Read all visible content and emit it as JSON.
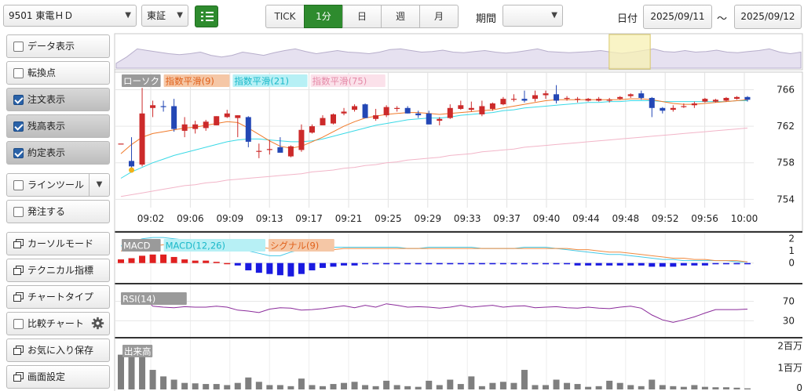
{
  "toolbar": {
    "stock": "9501 東電ＨＤ",
    "market": "東証",
    "timeframes": [
      "TICK",
      "1分",
      "日",
      "週",
      "月"
    ],
    "active_timeframe": "1分",
    "period_label": "期間",
    "period_value": "",
    "date_label": "日付",
    "date_from": "2025/09/11",
    "tilde": "～",
    "date_to": "2025/09/12"
  },
  "sidebar": {
    "items": [
      {
        "label": "データ表示",
        "kind": "checkbox",
        "checked": false
      },
      {
        "label": "転換点",
        "kind": "checkbox",
        "checked": false
      },
      {
        "label": "注文表示",
        "kind": "checkbox",
        "checked": true
      },
      {
        "label": "残高表示",
        "kind": "checkbox",
        "checked": true
      },
      {
        "label": "約定表示",
        "kind": "checkbox",
        "checked": true
      },
      {
        "label": "ラインツール",
        "kind": "checkbox-dropdown",
        "checked": false
      },
      {
        "label": "発注する",
        "kind": "checkbox",
        "checked": false
      },
      {
        "label": "カーソルモード",
        "kind": "window"
      },
      {
        "label": "テクニカル指標",
        "kind": "window"
      },
      {
        "label": "チャートタイプ",
        "kind": "window"
      },
      {
        "label": "比較チャート",
        "kind": "checkbox-gear",
        "checked": false
      },
      {
        "label": "お気に入り保存",
        "kind": "window"
      },
      {
        "label": "画面設定",
        "kind": "window"
      }
    ]
  },
  "colors": {
    "up": "#cc2a2a",
    "down": "#2347b5",
    "ema9": "#f07a2a",
    "ema21": "#3ad9e6",
    "ema75": "#f2b5c8",
    "macd": "#46c9e6",
    "signal": "#f08a40",
    "rsi": "#8a2a9a",
    "volume": "#7f7f7f",
    "accent": "#2e8b2e"
  },
  "chart_data": [
    {
      "type": "candlestick",
      "title": "",
      "legend": [
        "ローソク",
        "指数平滑(9)",
        "指数平滑(21)",
        "指数平滑(75)"
      ],
      "x_ticks": [
        "09:02",
        "09:06",
        "09:09",
        "09:13",
        "09:17",
        "09:21",
        "09:25",
        "09:29",
        "09:33",
        "09:37",
        "09:40",
        "09:44",
        "09:48",
        "09:52",
        "09:56",
        "10:00"
      ],
      "y_ticks": [
        766,
        762,
        758,
        754
      ],
      "ylim": [
        753,
        767.5
      ],
      "candles": [
        [
          760.1,
          760.1,
          760.1,
          760.1
        ],
        [
          758.2,
          760.8,
          757.1,
          757.6
        ],
        [
          757.8,
          766.2,
          757.6,
          763.4
        ],
        [
          764.0,
          764.8,
          763.0,
          764.3
        ],
        [
          764.2,
          764.8,
          763.6,
          764.1
        ],
        [
          764.2,
          765.0,
          761.4,
          761.7
        ],
        [
          761.5,
          763.0,
          760.8,
          762.2
        ],
        [
          761.7,
          762.6,
          761.2,
          762.2
        ],
        [
          761.8,
          762.7,
          761.5,
          762.5
        ],
        [
          762.1,
          763.1,
          762.1,
          763.1
        ],
        [
          763.0,
          763.8,
          762.9,
          763.4
        ],
        [
          762.9,
          763.2,
          760.8,
          763.2
        ],
        [
          763.0,
          763.1,
          759.7,
          760.3
        ],
        [
          759.3,
          760.1,
          758.5,
          759.3
        ],
        [
          759.4,
          760.5,
          758.9,
          759.5
        ],
        [
          759.7,
          760.8,
          759.2,
          759.1
        ],
        [
          758.7,
          759.9,
          758.6,
          759.8
        ],
        [
          759.4,
          762.2,
          759.2,
          761.6
        ],
        [
          761.3,
          762.2,
          761.2,
          762.0
        ],
        [
          762.1,
          763.2,
          762.1,
          762.9
        ],
        [
          762.3,
          763.4,
          762.2,
          763.3
        ],
        [
          763.4,
          764.0,
          763.2,
          763.6
        ],
        [
          763.8,
          764.4,
          763.6,
          764.2
        ],
        [
          764.4,
          764.5,
          762.9,
          762.9
        ],
        [
          762.8,
          763.9,
          762.6,
          763.2
        ],
        [
          763.2,
          764.3,
          763.0,
          764.1
        ],
        [
          764.0,
          764.2,
          763.6,
          764.0
        ],
        [
          764.0,
          764.2,
          763.4,
          763.4
        ],
        [
          763.4,
          763.7,
          762.9,
          763.2
        ],
        [
          763.4,
          763.7,
          762.2,
          762.2
        ],
        [
          762.6,
          763.0,
          762.1,
          762.8
        ],
        [
          762.9,
          764.4,
          762.8,
          764.0
        ],
        [
          763.9,
          764.8,
          763.8,
          764.3
        ],
        [
          763.8,
          764.7,
          763.6,
          764.0
        ],
        [
          763.3,
          764.8,
          763.1,
          764.2
        ],
        [
          763.9,
          764.6,
          763.7,
          764.5
        ],
        [
          764.4,
          765.2,
          764.3,
          765.0
        ],
        [
          765.0,
          765.5,
          764.7,
          765.0
        ],
        [
          765.0,
          765.9,
          764.6,
          764.8
        ],
        [
          765.0,
          765.9,
          764.7,
          765.4
        ],
        [
          765.4,
          765.9,
          765.0,
          765.6
        ],
        [
          765.5,
          766.5,
          764.5,
          764.8
        ],
        [
          765.1,
          765.3,
          764.8,
          765.1
        ],
        [
          765.0,
          765.2,
          764.6,
          765.0
        ],
        [
          764.8,
          765.1,
          764.7,
          765.0
        ],
        [
          764.8,
          765.2,
          764.7,
          765.0
        ],
        [
          764.8,
          765.1,
          764.6,
          764.9
        ],
        [
          765.0,
          765.3,
          764.9,
          765.2
        ],
        [
          765.3,
          765.6,
          765.1,
          765.5
        ],
        [
          765.6,
          765.9,
          764.9,
          765.1
        ],
        [
          765.1,
          765.2,
          763.0,
          764.0
        ],
        [
          764.0,
          764.1,
          763.4,
          763.7
        ],
        [
          763.8,
          764.3,
          763.6,
          764.0
        ],
        [
          764.2,
          764.5,
          764.0,
          764.2
        ],
        [
          764.3,
          764.7,
          764.0,
          764.5
        ],
        [
          764.7,
          765.1,
          764.6,
          765.0
        ],
        [
          764.7,
          765.0,
          764.6,
          764.9
        ],
        [
          764.8,
          765.2,
          764.7,
          765.1
        ],
        [
          765.0,
          765.3,
          764.9,
          765.2
        ],
        [
          765.2,
          765.3,
          764.7,
          764.9
        ]
      ],
      "ema9": [
        759.0,
        760.0,
        760.8,
        761.2,
        761.4,
        761.6,
        761.8,
        761.9,
        762.1,
        762.3,
        762.5,
        762.4,
        761.8,
        761.1,
        760.4,
        759.8,
        759.6,
        759.8,
        760.3,
        760.8,
        761.4,
        762.0,
        762.5,
        762.9,
        763.1,
        763.3,
        763.4,
        763.5,
        763.5,
        763.4,
        763.3,
        763.4,
        763.5,
        763.6,
        763.7,
        763.8,
        764.0,
        764.2,
        764.4,
        764.6,
        764.8,
        764.9,
        764.9,
        764.9,
        764.9,
        764.9,
        764.9,
        764.9,
        765.0,
        765.0,
        764.9,
        764.7,
        764.5,
        764.4,
        764.4,
        764.5,
        764.6,
        764.7,
        764.8,
        764.9
      ],
      "ema21": [
        756.3,
        757.0,
        757.5,
        758.0,
        758.4,
        758.8,
        759.1,
        759.4,
        759.7,
        760.0,
        760.3,
        760.5,
        760.6,
        760.6,
        760.5,
        760.4,
        760.3,
        760.3,
        760.4,
        760.6,
        760.9,
        761.2,
        761.5,
        761.8,
        762.1,
        762.3,
        762.5,
        762.7,
        762.8,
        762.9,
        762.9,
        763.0,
        763.2,
        763.3,
        763.4,
        763.5,
        763.7,
        763.8,
        764.0,
        764.1,
        764.2,
        764.3,
        764.4,
        764.5,
        764.6,
        764.6,
        764.7,
        764.7,
        764.8,
        764.8,
        764.8,
        764.7,
        764.7,
        764.7,
        764.7,
        764.7,
        764.7,
        764.7,
        764.8,
        764.8
      ],
      "ema75": [
        754.3,
        754.5,
        754.7,
        754.9,
        755.1,
        755.3,
        755.5,
        755.6,
        755.8,
        755.9,
        756.1,
        756.2,
        756.3,
        756.4,
        756.5,
        756.6,
        756.7,
        756.8,
        757.0,
        757.1,
        757.2,
        757.4,
        757.5,
        757.7,
        757.8,
        758.0,
        758.1,
        758.3,
        758.4,
        758.5,
        758.6,
        758.8,
        758.9,
        759.0,
        759.2,
        759.3,
        759.4,
        759.5,
        759.7,
        759.8,
        759.9,
        760.0,
        760.1,
        760.2,
        760.3,
        760.4,
        760.5,
        760.6,
        760.7,
        760.8,
        760.9,
        761.0,
        761.1,
        761.2,
        761.3,
        761.4,
        761.5,
        761.6,
        761.7,
        761.8
      ]
    },
    {
      "type": "macd",
      "legend": [
        "MACD",
        "MACD(12,26)",
        "シグナル(9)"
      ],
      "y_ticks": [
        2,
        1,
        0
      ],
      "ylim": [
        -1.5,
        2.3
      ],
      "macd": [
        1.4,
        1.7,
        2.0,
        2.1,
        2.1,
        2.0,
        1.9,
        1.8,
        1.7,
        1.8,
        1.6,
        1.3,
        1.0,
        0.8,
        0.6,
        0.6,
        0.9,
        1.1,
        1.2,
        1.3,
        1.3,
        1.3,
        1.3,
        1.3,
        1.3,
        1.3,
        1.3,
        1.2,
        1.2,
        1.3,
        1.3,
        1.3,
        1.3,
        1.3,
        1.2,
        1.2,
        1.2,
        1.2,
        1.3,
        1.3,
        1.3,
        1.2,
        1.1,
        1.0,
        0.9,
        0.8,
        0.7,
        0.7,
        0.6,
        0.5,
        0.4,
        0.3,
        0.3,
        0.2,
        0.2,
        0.2,
        0.2,
        0.2,
        0.1,
        0.1
      ],
      "signal": [
        1.0,
        1.1,
        1.3,
        1.4,
        1.5,
        1.6,
        1.6,
        1.6,
        1.6,
        1.6,
        1.6,
        1.5,
        1.4,
        1.3,
        1.2,
        1.1,
        1.0,
        1.0,
        1.0,
        1.1,
        1.1,
        1.2,
        1.2,
        1.2,
        1.2,
        1.2,
        1.2,
        1.2,
        1.2,
        1.2,
        1.2,
        1.2,
        1.2,
        1.2,
        1.2,
        1.2,
        1.2,
        1.2,
        1.2,
        1.2,
        1.2,
        1.2,
        1.2,
        1.1,
        1.1,
        1.0,
        0.9,
        0.9,
        0.8,
        0.7,
        0.6,
        0.5,
        0.4,
        0.4,
        0.3,
        0.3,
        0.2,
        0.2,
        0.2,
        0.1
      ],
      "histogram": [
        0.3,
        0.4,
        0.6,
        0.7,
        0.7,
        0.5,
        0.3,
        0.2,
        0.2,
        0.1,
        0.0,
        -0.2,
        -0.6,
        -0.8,
        -0.9,
        -1.0,
        -1.1,
        -0.9,
        -0.6,
        -0.4,
        -0.3,
        -0.2,
        -0.2,
        -0.1,
        -0.1,
        -0.1,
        -0.1,
        -0.1,
        -0.1,
        -0.1,
        -0.1,
        -0.1,
        -0.1,
        -0.1,
        -0.1,
        -0.1,
        -0.1,
        -0.1,
        -0.1,
        -0.1,
        -0.1,
        -0.1,
        -0.1,
        -0.2,
        -0.2,
        -0.2,
        -0.2,
        -0.2,
        -0.2,
        -0.2,
        -0.3,
        -0.3,
        -0.3,
        -0.2,
        -0.2,
        -0.2,
        -0.1,
        -0.1,
        -0.1,
        -0.1
      ]
    },
    {
      "type": "line",
      "legend": [
        "RSI(14)"
      ],
      "y_ticks": [
        70,
        30
      ],
      "ylim": [
        0,
        100
      ],
      "values": [
        86,
        80,
        82,
        60,
        58,
        57,
        59,
        58,
        58,
        60,
        58,
        52,
        50,
        47,
        54,
        57,
        56,
        52,
        53,
        55,
        58,
        61,
        57,
        62,
        58,
        65,
        62,
        58,
        59,
        58,
        56,
        58,
        62,
        58,
        60,
        62,
        58,
        60,
        61,
        57,
        58,
        59,
        57,
        56,
        58,
        56,
        55,
        58,
        60,
        56,
        42,
        32,
        27,
        32,
        38,
        46,
        53,
        53,
        53,
        54
      ]
    },
    {
      "type": "bar",
      "legend": [
        "出来高"
      ],
      "y_ticks": [
        "2百万",
        "1百万",
        "0"
      ],
      "ylim": [
        0,
        2.2
      ],
      "values": [
        1.6,
        1.9,
        1.6,
        0.9,
        0.6,
        0.45,
        0.3,
        0.28,
        0.25,
        0.25,
        0.2,
        0.3,
        0.55,
        0.35,
        0.2,
        0.2,
        0.15,
        0.5,
        0.2,
        0.15,
        0.25,
        0.3,
        0.35,
        0.2,
        0.15,
        0.4,
        0.2,
        0.15,
        0.12,
        0.4,
        0.2,
        0.45,
        0.25,
        0.6,
        0.15,
        0.3,
        0.35,
        0.3,
        0.9,
        0.2,
        0.2,
        0.45,
        0.3,
        0.25,
        0.12,
        0.15,
        0.4,
        0.3,
        0.2,
        0.15,
        0.45,
        0.2,
        0.15,
        0.12,
        0.2,
        0.12,
        0.1,
        0.1,
        0.08,
        0.05
      ]
    }
  ],
  "overview": {
    "values": [
      0.15,
      0.35,
      0.6,
      0.55,
      0.5,
      0.45,
      0.42,
      0.45,
      0.5,
      0.4,
      0.35,
      0.4,
      0.5,
      0.45,
      0.4,
      0.48,
      0.55,
      0.6,
      0.52,
      0.45,
      0.5,
      0.55,
      0.5,
      0.48,
      0.45,
      0.5,
      0.58,
      0.6,
      0.55,
      0.5,
      0.52,
      0.56,
      0.5,
      0.48,
      0.52,
      0.55,
      0.5,
      0.47,
      0.5,
      0.55,
      0.6,
      0.52,
      0.5,
      0.48,
      0.5,
      0.52,
      0.55,
      0.5,
      0.46,
      0.5,
      0.55,
      0.6,
      0.52,
      0.5,
      0.55,
      0.5,
      0.52,
      0.56,
      0.5,
      0.48,
      0.52,
      0.55,
      0.6,
      0.5,
      0.45,
      0.5
    ],
    "highlight_from": 0.72,
    "highlight_to": 0.78
  }
}
